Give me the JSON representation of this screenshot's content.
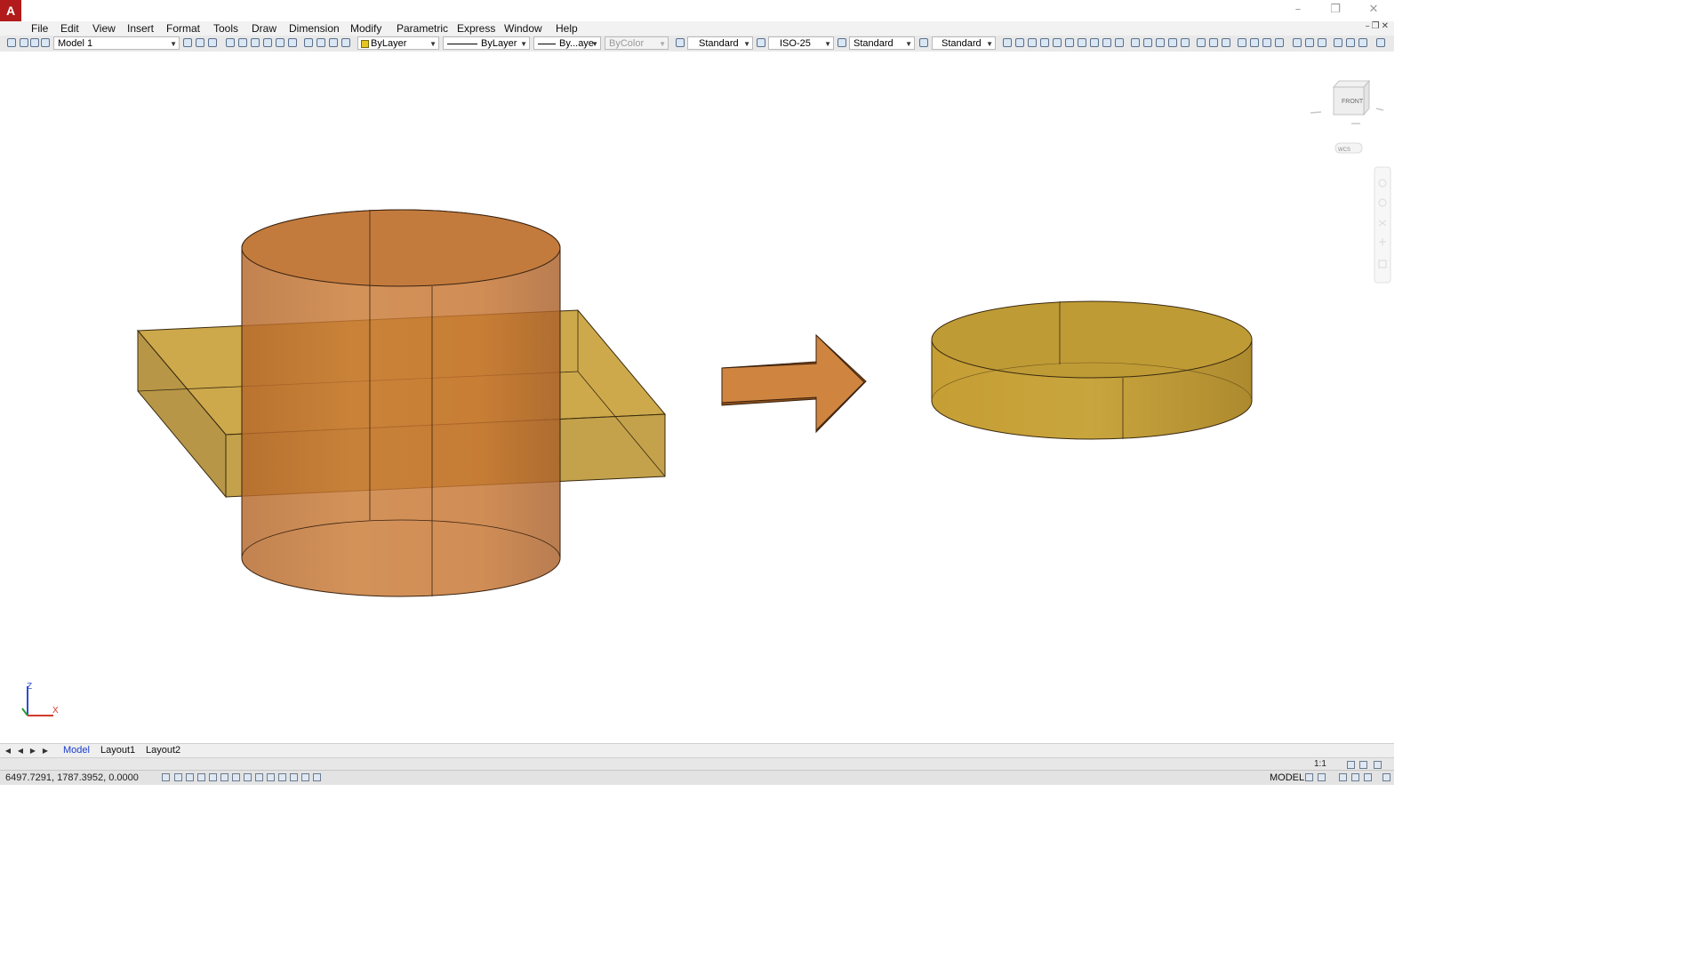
{
  "menu": [
    "File",
    "Edit",
    "View",
    "Insert",
    "Format",
    "Tools",
    "Draw",
    "Dimension",
    "Modify",
    "Parametric",
    "Express",
    "Window",
    "Help"
  ],
  "toolbar": {
    "workspace": "Model 1",
    "layer_color": "ByLayer",
    "linetype": "ByLayer",
    "lineweight": "By...aye",
    "plot_style": "ByColor",
    "text_style": "Standard",
    "dim_style": "ISO-25",
    "table_style": "Standard",
    "mleader_style": "Standard"
  },
  "viewcube": {
    "face": "FRONT",
    "wcs": "WCS"
  },
  "ucs": {
    "z": "Z",
    "x": "X"
  },
  "tabs": [
    "Model",
    "Layout1",
    "Layout2"
  ],
  "status": {
    "coords": "6497.7291, 1787.3952, 0.0000",
    "space": "MODEL",
    "scale": "1:1"
  },
  "colors": {
    "cylinder": "#c7772f",
    "box": "#c49a2c",
    "arrow": "#cf8540",
    "disc": "#bf9b35"
  }
}
